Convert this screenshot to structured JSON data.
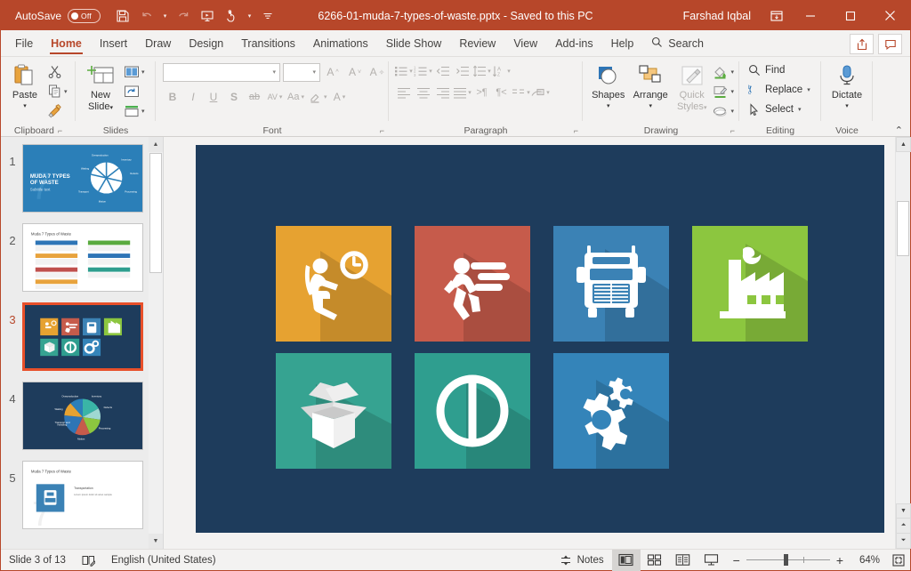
{
  "titlebar": {
    "autosave_label": "AutoSave",
    "autosave_state": "Off",
    "document_title": "6266-01-muda-7-types-of-waste.pptx  -  Saved to this PC",
    "user_name": "Farshad Iqbal",
    "qat": [
      {
        "name": "save-icon",
        "label": "Save"
      },
      {
        "name": "undo-icon",
        "label": "Undo"
      },
      {
        "name": "redo-icon",
        "label": "Redo"
      },
      {
        "name": "start-from-beginning-icon",
        "label": "Start From Beginning"
      },
      {
        "name": "touch-mode-icon",
        "label": "Touch/Mouse Mode"
      },
      {
        "name": "customize-qat-icon",
        "label": "Customize Quick Access Toolbar"
      }
    ],
    "window": {
      "ribbon_display_options": "Ribbon Display Options",
      "minimize": "Minimize",
      "maximize": "Maximize",
      "close": "Close"
    }
  },
  "tabs": [
    {
      "label": "File",
      "active": false
    },
    {
      "label": "Home",
      "active": true
    },
    {
      "label": "Insert",
      "active": false
    },
    {
      "label": "Draw",
      "active": false
    },
    {
      "label": "Design",
      "active": false
    },
    {
      "label": "Transitions",
      "active": false
    },
    {
      "label": "Animations",
      "active": false
    },
    {
      "label": "Slide Show",
      "active": false
    },
    {
      "label": "Review",
      "active": false
    },
    {
      "label": "View",
      "active": false
    },
    {
      "label": "Add-ins",
      "active": false
    },
    {
      "label": "Help",
      "active": false
    }
  ],
  "search": {
    "label": "Search",
    "icon": "search-icon"
  },
  "tabrow_right": [
    {
      "name": "share-button",
      "label": "Share"
    },
    {
      "name": "comments-button",
      "label": "Comments"
    }
  ],
  "ribbon": {
    "clipboard": {
      "group_label": "Clipboard",
      "paste_label": "Paste",
      "cut_label": "Cut",
      "copy_label": "Copy",
      "format_painter_label": "Format Painter",
      "dialog_launcher": "Clipboard dialog box launcher"
    },
    "slides": {
      "group_label": "Slides",
      "new_slide_label": "New\nSlide",
      "new_slide_line1": "New",
      "new_slide_line2": "Slide",
      "layout_label": "Layout",
      "reset_label": "Reset",
      "section_label": "Section"
    },
    "font": {
      "group_label": "Font",
      "font_name_value": "",
      "font_size_value": "",
      "increase_font": "A",
      "decrease_font": "A",
      "clear_formatting": "Clear All Formatting",
      "bold": "B",
      "italic": "I",
      "underline": "U",
      "shadow": "S",
      "strikethrough": "ab",
      "char_spacing": "AV",
      "change_case": "Aa",
      "text_highlight": "Text Highlight Color",
      "font_color": "A",
      "dialog_launcher": "Font dialog box launcher"
    },
    "paragraph": {
      "group_label": "Paragraph",
      "bullets": "Bullets",
      "numbering": "Numbering",
      "decrease_indent": "Decrease List Level",
      "increase_indent": "Increase List Level",
      "line_spacing": "Line Spacing",
      "align_left": "Align Left",
      "align_center": "Center",
      "align_right": "Align Right",
      "justify": "Justify",
      "columns": "Add or Remove Columns",
      "text_direction": "Text Direction",
      "align_text": "Align Text",
      "smartart": "Convert to SmartArt",
      "dialog_launcher": "Paragraph dialog box launcher"
    },
    "drawing": {
      "group_label": "Drawing",
      "shapes_label": "Shapes",
      "arrange_label": "Arrange",
      "quick_styles_line1": "Quick",
      "quick_styles_line2": "Styles",
      "shape_fill": "Shape Fill",
      "shape_outline": "Shape Outline",
      "shape_effects": "Shape Effects",
      "dialog_launcher": "Drawing dialog box launcher"
    },
    "editing": {
      "group_label": "Editing",
      "find_label": "Find",
      "replace_label": "Replace",
      "select_label": "Select"
    },
    "voice": {
      "group_label": "Voice",
      "dictate_label": "Dictate"
    },
    "collapse_ribbon": "Collapse the Ribbon"
  },
  "thumbnails": {
    "scroll_up": "Scroll up",
    "scroll_down": "Scroll down",
    "slides": [
      {
        "number": "1",
        "selected": false,
        "kind": "title-pie",
        "title": "MUDA 7 TYPES OF WASTE"
      },
      {
        "number": "2",
        "selected": false,
        "kind": "seven-boxes",
        "title": "Muda 7 Types of Waste"
      },
      {
        "number": "3",
        "selected": true,
        "kind": "icon-tiles",
        "title": "Icon tiles"
      },
      {
        "number": "4",
        "selected": false,
        "kind": "pie-dark",
        "title": "Pie chart"
      },
      {
        "number": "5",
        "selected": false,
        "kind": "truck-detail",
        "title": "Muda 7 Types of Waste"
      }
    ]
  },
  "slide": {
    "background_color": "#1e3c5c",
    "tiles": [
      {
        "name": "waiting-icon-tile",
        "icon": "person-waiting-clock-icon",
        "color": "#e6a231",
        "shadow": "#c4882a"
      },
      {
        "name": "motion-icon-tile",
        "icon": "running-person-icon",
        "color": "#c65b4b",
        "shadow": "#a94a3c"
      },
      {
        "name": "transportation-icon-tile",
        "icon": "truck-icon",
        "color": "#3b82b5",
        "shadow": "#2f6d9b"
      },
      {
        "name": "overprocessing-icon-tile",
        "icon": "factory-icon",
        "color": "#8cc63f",
        "shadow": "#74ad2e"
      },
      {
        "name": "inventory-icon-tile",
        "icon": "open-box-icon",
        "color": "#36a391",
        "shadow": "#2c8a7b"
      },
      {
        "name": "defects-icon-tile",
        "icon": "circle-bar-icon",
        "color": "#2f9e8f",
        "shadow": "#258377"
      },
      {
        "name": "overproduction-icon-tile",
        "icon": "gears-icon",
        "color": "#3484b9",
        "shadow": "#2a6f9e"
      }
    ]
  },
  "canvas_scroll": {
    "scroll_up": "Scroll up",
    "scroll_down": "Scroll down",
    "previous_slide": "Previous Slide",
    "next_slide": "Next Slide"
  },
  "statusbar": {
    "slide_counter": "Slide 3 of 13",
    "spellcheck_icon": "spell-check-icon",
    "language": "English (United States)",
    "notes_label": "Notes",
    "views": [
      {
        "name": "normal-view-button",
        "icon": "normal-view-icon",
        "active": true
      },
      {
        "name": "slide-sorter-view-button",
        "icon": "slide-sorter-icon",
        "active": false
      },
      {
        "name": "reading-view-button",
        "icon": "reading-view-icon",
        "active": false
      },
      {
        "name": "slideshow-view-button",
        "icon": "slideshow-icon",
        "active": false
      }
    ],
    "zoom_out": "−",
    "zoom_in": "+",
    "zoom_level": "64%",
    "fit_to_window": "Fit slide to current window"
  }
}
